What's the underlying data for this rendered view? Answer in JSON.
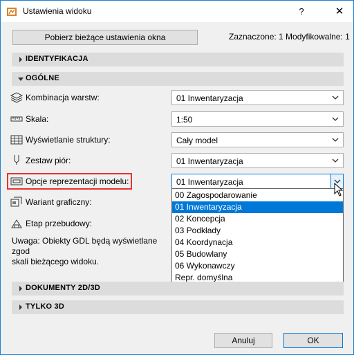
{
  "window": {
    "title": "Ustawienia widoku",
    "help_glyph": "?",
    "close_glyph": "✕"
  },
  "toolbar": {
    "fetch_button": "Pobierz bieżące ustawienia okna",
    "status": "Zaznaczone: 1 Modyfikowalne: 1"
  },
  "sections": {
    "identyfikacja": "IDENTYFIKACJA",
    "ogolne": "OGÓLNE",
    "dokumenty": "DOKUMENTY 2D/3D",
    "tylko3d": "TYLKO 3D"
  },
  "rows": {
    "kombinacja": {
      "label": "Kombinacja warstw:",
      "value": "01 Inwentaryzacja",
      "icon": "layers-icon"
    },
    "skala": {
      "label": "Skala:",
      "value": "1:50",
      "icon": "scale-icon"
    },
    "struktura": {
      "label": "Wyświetlanie struktury:",
      "value": "Cały model",
      "icon": "structure-icon"
    },
    "piora": {
      "label": "Zestaw piór:",
      "value": "01 Inwentaryzacja",
      "icon": "pen-icon"
    },
    "opcje": {
      "label": "Opcje reprezentacji modelu:",
      "value": "01 Inwentaryzacja",
      "icon": "model-display-icon"
    },
    "wariant": {
      "label": "Wariant graficzny:",
      "icon": "graphic-override-icon"
    },
    "etap": {
      "label": "Etap przebudowy:",
      "icon": "renovation-icon"
    }
  },
  "dropdown": {
    "items": [
      "00 Zagospodarowanie",
      "01 Inwentaryzacja",
      "02 Koncepcja",
      "03 Podkłady",
      "04 Koordynacja",
      "05 Budowlany",
      "06 Wykonawczy",
      "Repr. domyślna"
    ],
    "selected_index": 1
  },
  "note": {
    "line1": "Uwaga: Obiekty GDL będą wyświetlane zgod",
    "line2": "skali bieżącego widoku."
  },
  "footer": {
    "cancel": "Anuluj",
    "ok": "OK"
  },
  "colors": {
    "accent": "#0078d7",
    "highlight": "#e8312f",
    "section_bg": "#dcdcdc"
  }
}
